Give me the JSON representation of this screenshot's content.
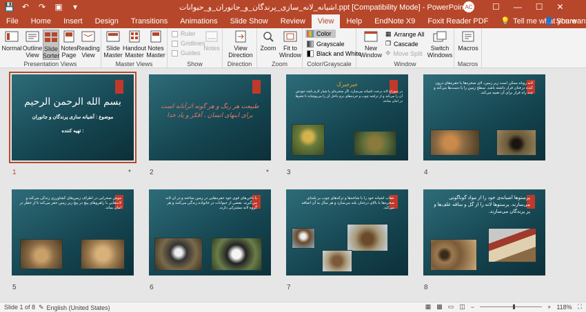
{
  "titlebar": {
    "title": "اشیانه_لانه_سازی_پرندگان_و_جانوران_و_حیوانات.ppt [Compatibility Mode] - PowerPoint",
    "user_initials": "AC",
    "save_icon": "💾",
    "undo_icon": "↶",
    "redo_icon": "↷",
    "start_icon": "▣",
    "qat_more": "▾",
    "restore": "☐",
    "min": "—",
    "max": "☐",
    "close": "✕"
  },
  "tabs": [
    "File",
    "Home",
    "Insert",
    "Design",
    "Transitions",
    "Animations",
    "Slide Show",
    "Review",
    "View",
    "Help",
    "EndNote X9",
    "Foxit Reader PDF"
  ],
  "active_tab": "View",
  "tell_me": "Tell me what you want to do",
  "share": "Share",
  "ribbon": {
    "presentation_views": {
      "label": "Presentation Views",
      "buttons": [
        "Normal",
        "Outline\nView",
        "Slide\nSorter",
        "Notes\nPage",
        "Reading\nView"
      ]
    },
    "master_views": {
      "label": "Master Views",
      "buttons": [
        "Slide\nMaster",
        "Handout\nMaster",
        "Notes\nMaster"
      ]
    },
    "show": {
      "label": "Show",
      "items": [
        "Ruler",
        "Gridlines",
        "Guides"
      ],
      "notes": "Notes"
    },
    "direction": {
      "label": "Direction",
      "button": "View\nDirection"
    },
    "zoom": {
      "label": "Zoom",
      "buttons": [
        "Zoom",
        "Fit to\nWindow"
      ]
    },
    "color": {
      "label": "Color/Grayscale",
      "items": [
        "Color",
        "Grayscale",
        "Black and White"
      ]
    },
    "window": {
      "label": "Window",
      "new_window": "New\nWindow",
      "items": [
        "Arrange All",
        "Cascade",
        "Move Split"
      ],
      "switch": "Switch\nWindows"
    },
    "macros": {
      "label": "Macros",
      "button": "Macros"
    }
  },
  "slides": [
    {
      "number": "1",
      "title": "بسم الله الرحمن الرحيم",
      "subtitle": "موضوع : آشیانه سازی پرندگان و جانوران",
      "line3": "تهیه کننده :",
      "star": "*"
    },
    {
      "number": "2",
      "text": "طبیعت هر رنگ و هر گونه اثرآنانه است برای ابنهای انسان ، آفکر و یاد خدا",
      "star": "*"
    },
    {
      "number": "3",
      "heading": "جیرجیرک",
      "body": "در سوراخ لانه درخت آشیانه می‌سازد. اگر سخره‌ای یا شیار لازم باشد خودش آن را می‌کند و از تراشه چوب و خرده‌های نرم داخل آن را می‌پوشاند تا تخم‌ها در امان بمانند."
    },
    {
      "number": "4",
      "body": "لانه روباه ممکن است زیر زمین، لای صخره‌ها یا حفره‌های درون کنده درختان قرار داشته باشد. سطح زمین را با دست‌ها می‌کند و چند راه فرار برای آن تعبیه می‌کند."
    },
    {
      "number": "5",
      "body": "موش صحرایی در اطراف زمین‌های کشاورزی زندگی می‌کند و لانه‌هایی با راهروهای پیچ در پیچ زیر زمین حفر می‌کند تا از خطر در امان بماند."
    },
    {
      "number": "6",
      "body": "با ناخن‌های قوی خود حفره‌هایی در زمین ساخته و در آن لانه می‌گیرند. بعضی از حیوانات در خانواده زندگی می‌کنند و هر گروه لانه مشترکی دارند."
    },
    {
      "number": "7",
      "body": "عقاب آشیانه خود را با شاخه‌ها و ترکه‌های چوب بر بلندای صخره‌ها یا بالای درختان بلند می‌سازد و هر سال به آن اضافه می‌کند."
    },
    {
      "number": "8",
      "body": "پرستوها آشیانه‌ی خود را از مواد گوناگونی می‌سازند. پرستوها لانه را از گل و ساقه علف‌ها و پر پرندگان می‌سازند."
    }
  ],
  "status": {
    "slide_of": "Slide 1 of 8",
    "language": "English (United States)",
    "zoom": "118%",
    "zoom_minus": "−",
    "zoom_plus": "+"
  },
  "colors": {
    "accent": "#b7472a",
    "slide_bg": "#1b4f5c",
    "slide_red": "#c0392b"
  }
}
